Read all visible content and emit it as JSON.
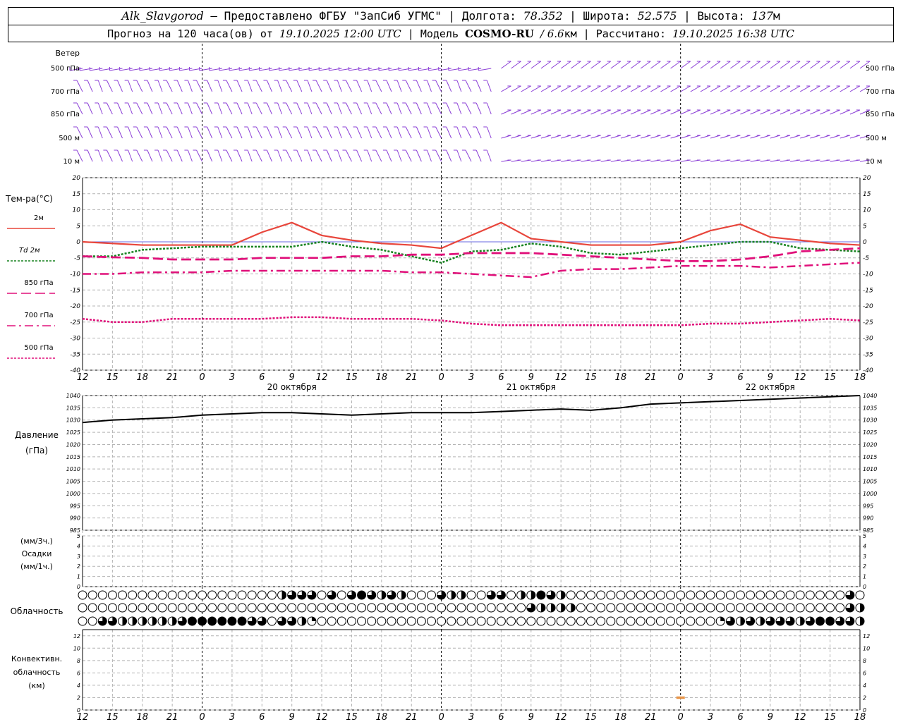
{
  "header": {
    "station": "Alk_Slavgorod",
    "dash": " — ",
    "provider": "Предоставлено ФГБУ \"ЗапСиб УГМС\"",
    "lon_label": "Долгота:",
    "lon_value": "78.352",
    "lat_label": "Широта:",
    "lat_value": "52.575",
    "alt_label": "Высота:",
    "alt_value": "137",
    "alt_unit": "м",
    "forecast_prefix": "Прогноз на 120 часа(ов) от",
    "forecast_start": "19.10.2025 12:00 UTC",
    "model_label": "Модель",
    "model_name": "COSMO-RU",
    "model_res": "/ 6.6",
    "model_res_unit": "км",
    "computed_label": "Рассчитано:",
    "computed_value": "19.10.2025 16:38 UTC",
    "sep": " | "
  },
  "labels": {
    "wind": "Ветер",
    "wind_levels": [
      "500 гПа",
      "700 гПа",
      "850 гПа",
      "500 м",
      "10  м"
    ],
    "temp": "Тем-ра(°C)",
    "temp_legend": [
      "2м",
      "Td  2м",
      "850 гПа",
      "700 гПа",
      "500 гПа"
    ],
    "pressure": [
      "Давление",
      "(гПа)"
    ],
    "precip": [
      "(мм/3ч.)",
      "Осадки",
      "(мм/1ч.)"
    ],
    "cloud": "Облачность",
    "conv": [
      "Конвективн.",
      "облачность",
      "(км)"
    ]
  },
  "time_ticks": [
    "12",
    "15",
    "18",
    "21",
    "0",
    "3",
    "6",
    "9",
    "12",
    "15",
    "18",
    "21",
    "0",
    "3",
    "6",
    "9",
    "12",
    "15",
    "18",
    "21",
    "0",
    "3",
    "6",
    "9",
    "12",
    "15",
    "18"
  ],
  "day_labels": [
    {
      "text": "20 октября",
      "hour": 21
    },
    {
      "text": "21 октября",
      "hour": 45
    },
    {
      "text": "22 октября",
      "hour": 69
    }
  ],
  "colors": {
    "t2m": "#e8463c",
    "td2m": "#16821f",
    "t850": "#e0107a",
    "t700": "#e0107a",
    "t500": "#e0107a",
    "wind": "#8b3fd6",
    "grid": "#b4b4b4",
    "conv": "#e8964a"
  },
  "chart_data": [
    {
      "type": "line",
      "title": "Тем-ра(°C)",
      "x_unit": "hours from 19.10.2025 12:00 UTC",
      "ylim": [
        -40,
        20
      ],
      "y_ticks": [
        20,
        15,
        10,
        5,
        0,
        -5,
        -10,
        -15,
        -20,
        -25,
        -30,
        -35,
        -40
      ],
      "grid": true,
      "x": [
        0,
        3,
        6,
        9,
        12,
        15,
        18,
        21,
        24,
        27,
        30,
        33,
        36,
        39,
        42,
        45,
        48,
        51,
        54,
        57,
        60,
        63,
        66,
        69,
        72,
        75,
        78
      ],
      "series": [
        {
          "name": "2м",
          "values": [
            0,
            -0.5,
            -1,
            -1,
            -1,
            -1,
            3,
            6,
            2,
            0.5,
            -0.5,
            -1,
            -2,
            2,
            6,
            1,
            0,
            -1,
            -1,
            -1,
            0,
            3.5,
            5.5,
            1.5,
            0.5,
            -0.5,
            -1
          ]
        },
        {
          "name": "Td 2м",
          "values": [
            -4.5,
            -4.5,
            -2.5,
            -2,
            -1.5,
            -1.5,
            -1.5,
            -1.5,
            0,
            -1.5,
            -2.5,
            -4.5,
            -6.5,
            -3,
            -2.5,
            -0.5,
            -1.5,
            -3.5,
            -4,
            -3,
            -2,
            -1,
            0,
            0,
            -2,
            -2.5,
            -3
          ]
        },
        {
          "name": "850 гПа",
          "values": [
            -4.5,
            -4.8,
            -5,
            -5.5,
            -5.5,
            -5.5,
            -5,
            -5,
            -5,
            -4.5,
            -4.5,
            -4,
            -4,
            -3.5,
            -3.5,
            -3.5,
            -4,
            -4.5,
            -5,
            -5.5,
            -6,
            -6,
            -5.5,
            -4.5,
            -3,
            -2.5,
            -2
          ]
        },
        {
          "name": "700 гПа",
          "values": [
            -10,
            -10,
            -9.5,
            -9.5,
            -9.5,
            -9,
            -9,
            -9,
            -9,
            -9,
            -9,
            -9.5,
            -9.5,
            -10,
            -10.5,
            -11,
            -9,
            -8.5,
            -8.5,
            -8,
            -7.5,
            -7.5,
            -7.5,
            -8,
            -7.5,
            -7,
            -6.5
          ]
        },
        {
          "name": "500 гПа",
          "values": [
            -24,
            -25,
            -25,
            -24,
            -24,
            -24,
            -24,
            -23.5,
            -23.5,
            -24,
            -24,
            -24,
            -24.5,
            -25.5,
            -26,
            -26,
            -26,
            -26,
            -26,
            -26,
            -26,
            -25.5,
            -25.5,
            -25,
            -24.5,
            -24,
            -24.5
          ]
        }
      ]
    },
    {
      "type": "line",
      "title": "Давление (гПа)",
      "x_unit": "hours from 19.10.2025 12:00 UTC",
      "ylim": [
        985,
        1040
      ],
      "y_ticks": [
        1040,
        1035,
        1030,
        1025,
        1020,
        1015,
        1010,
        1005,
        1000,
        995,
        990,
        985
      ],
      "grid": true,
      "x": [
        0,
        3,
        6,
        9,
        12,
        15,
        18,
        21,
        24,
        27,
        30,
        33,
        36,
        39,
        42,
        45,
        48,
        51,
        54,
        57,
        60,
        63,
        66,
        69,
        72,
        75,
        78
      ],
      "series": [
        {
          "values": [
            1029,
            1030,
            1030.5,
            1031,
            1032,
            1032.5,
            1033,
            1033,
            1032.5,
            1032,
            1032.5,
            1033,
            1033,
            1033,
            1033.5,
            1034,
            1034.5,
            1034,
            1035,
            1036.5,
            1037,
            1037.5,
            1038,
            1038.5,
            1039,
            1039.5,
            1040
          ]
        }
      ]
    },
    {
      "type": "bar",
      "title": "Осадки",
      "x_unit": "hours from 19.10.2025 12:00 UTC",
      "ylim": [
        0,
        5
      ],
      "y_ticks": [
        5,
        4,
        3,
        2,
        1,
        0
      ],
      "x": [],
      "values": []
    },
    {
      "type": "table",
      "title": "Облачность",
      "rows_note": "cloud cover in eighths, 3 rows (upper / middle / lower), one symbol per hour 0..78",
      "rows": [
        [
          0,
          0,
          0,
          0,
          0,
          0,
          0,
          0,
          0,
          0,
          0,
          0,
          0,
          0,
          0,
          0,
          0,
          0,
          0,
          0,
          4,
          6,
          6,
          6,
          0,
          6,
          0,
          6,
          8,
          6,
          4,
          6,
          4,
          0,
          0,
          0,
          6,
          4,
          4,
          0,
          0,
          6,
          6,
          0,
          4,
          4,
          8,
          6,
          4,
          0,
          0,
          0,
          0,
          0,
          0,
          0,
          0,
          0,
          0,
          0,
          0,
          0,
          0,
          0,
          0,
          0,
          0,
          0,
          0,
          0,
          0,
          0,
          0,
          0,
          0,
          0,
          0,
          6,
          0
        ],
        [
          0,
          0,
          0,
          0,
          0,
          0,
          0,
          0,
          0,
          0,
          0,
          0,
          0,
          0,
          0,
          0,
          0,
          0,
          0,
          0,
          0,
          0,
          0,
          0,
          0,
          0,
          0,
          0,
          0,
          0,
          0,
          0,
          0,
          0,
          0,
          0,
          0,
          0,
          0,
          0,
          0,
          0,
          0,
          0,
          0,
          6,
          4,
          4,
          4,
          4,
          0,
          0,
          0,
          0,
          0,
          0,
          0,
          0,
          0,
          0,
          0,
          0,
          0,
          0,
          0,
          0,
          0,
          0,
          0,
          0,
          0,
          0,
          0,
          0,
          0,
          0,
          0,
          6,
          4
        ],
        [
          0,
          0,
          6,
          6,
          4,
          4,
          4,
          4,
          4,
          4,
          6,
          8,
          8,
          8,
          8,
          8,
          8,
          6,
          6,
          0,
          6,
          6,
          4,
          2,
          0,
          0,
          0,
          0,
          0,
          0,
          0,
          0,
          0,
          0,
          0,
          0,
          0,
          0,
          0,
          0,
          0,
          0,
          0,
          0,
          0,
          0,
          0,
          0,
          0,
          0,
          0,
          0,
          0,
          0,
          0,
          0,
          0,
          0,
          0,
          0,
          0,
          0,
          0,
          0,
          2,
          6,
          4,
          6,
          4,
          6,
          6,
          6,
          4,
          6,
          8,
          8,
          6,
          6,
          4,
          0,
          0,
          0,
          0,
          0,
          0
        ]
      ]
    },
    {
      "type": "bar",
      "title": "Конвективн. облачность (км)",
      "x_unit": "hours from 19.10.2025 12:00 UTC",
      "ylim": [
        0,
        13
      ],
      "y_ticks": [
        12,
        10,
        8,
        6,
        4,
        2,
        0
      ],
      "bars": [
        {
          "x": 60,
          "bottom": 1.8,
          "top": 2.2
        }
      ]
    }
  ]
}
